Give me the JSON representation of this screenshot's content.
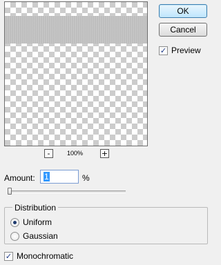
{
  "dialog": {
    "ok_label": "OK",
    "cancel_label": "Cancel",
    "preview_label": "Preview",
    "preview_checked": true
  },
  "zoom": {
    "minus_glyph": "-",
    "plus_glyph": "+",
    "level": "100%"
  },
  "amount": {
    "label": "Amount:",
    "value": "1",
    "unit": "%",
    "slider_fraction": 0.01
  },
  "distribution": {
    "title": "Distribution",
    "options": [
      {
        "label": "Uniform",
        "selected": true
      },
      {
        "label": "Gaussian",
        "selected": false
      }
    ]
  },
  "monochromatic": {
    "label": "Monochromatic",
    "checked": true
  },
  "icons": {
    "check": "✓"
  }
}
